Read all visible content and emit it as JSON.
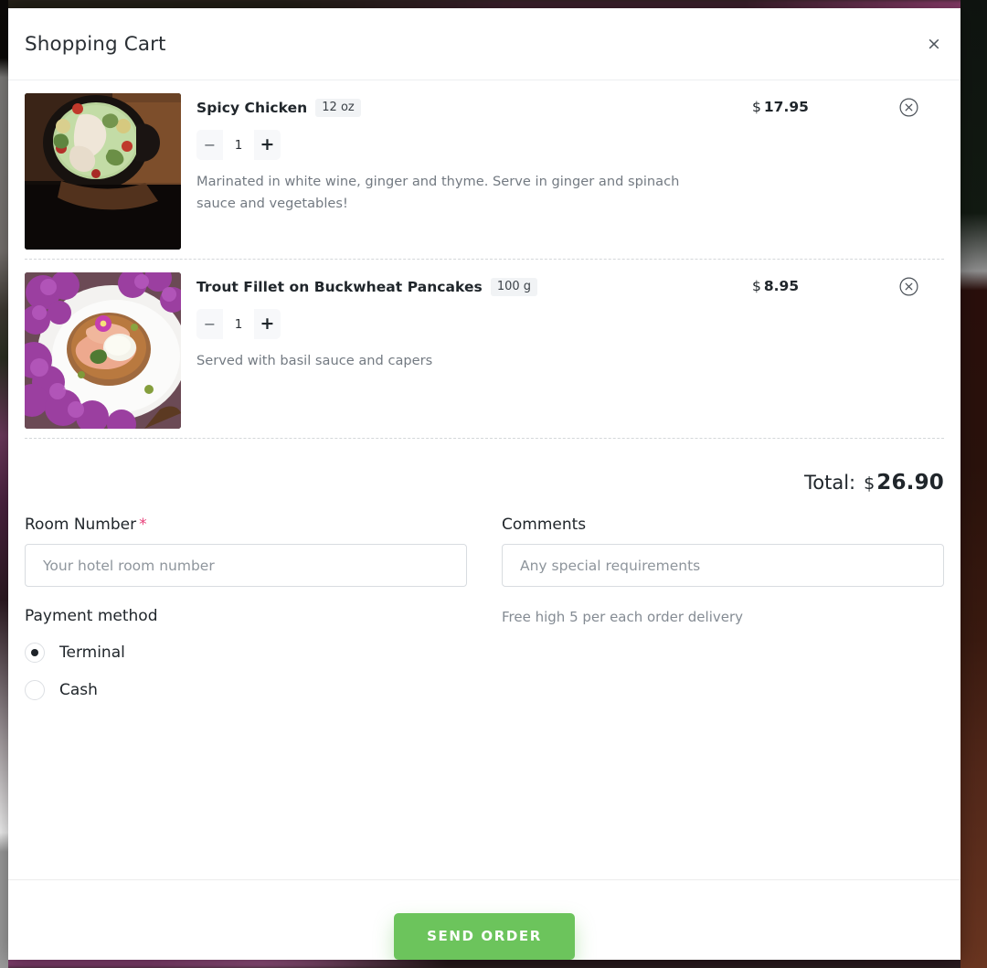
{
  "modal": {
    "title": "Shopping Cart",
    "close_icon": "close-icon",
    "close_label": "×"
  },
  "cart": {
    "items": [
      {
        "name": "Spicy Chicken",
        "weight": "12 oz",
        "quantity": "1",
        "decrement_label": "−",
        "increment_label": "+",
        "description": "Marinated in white wine, ginger and thyme. Serve in ginger and spinach sauce and vegetables!",
        "currency": "$",
        "price": "17.95",
        "remove_icon": "remove-circle-icon",
        "image_alt": "green curry chicken in black pot"
      },
      {
        "name": "Trout Fillet on Buckwheat Pancakes",
        "weight": "100 g",
        "quantity": "1",
        "decrement_label": "−",
        "increment_label": "+",
        "description": "Served with basil sauce and capers",
        "currency": "$",
        "price": "8.95",
        "remove_icon": "remove-circle-icon",
        "image_alt": "trout tartare on plate with lilac flowers"
      }
    ],
    "total_label": "Total:",
    "total_currency": "$",
    "total_amount": "26.90"
  },
  "form": {
    "room": {
      "label": "Room Number",
      "required_marker": "*",
      "placeholder": "Your hotel room number",
      "value": ""
    },
    "comments": {
      "label": "Comments",
      "placeholder": "Any special requirements",
      "value": ""
    },
    "payment": {
      "title": "Payment method",
      "options": [
        {
          "label": "Terminal",
          "selected": true
        },
        {
          "label": "Cash",
          "selected": false
        }
      ]
    },
    "delivery_note": "Free high 5 per each order delivery"
  },
  "footer": {
    "send_label": "SEND ORDER"
  },
  "colors": {
    "accent_green": "#6cc45c",
    "required_pink": "#e8417a",
    "text_dark": "#20262b",
    "text_muted": "#737a82"
  }
}
